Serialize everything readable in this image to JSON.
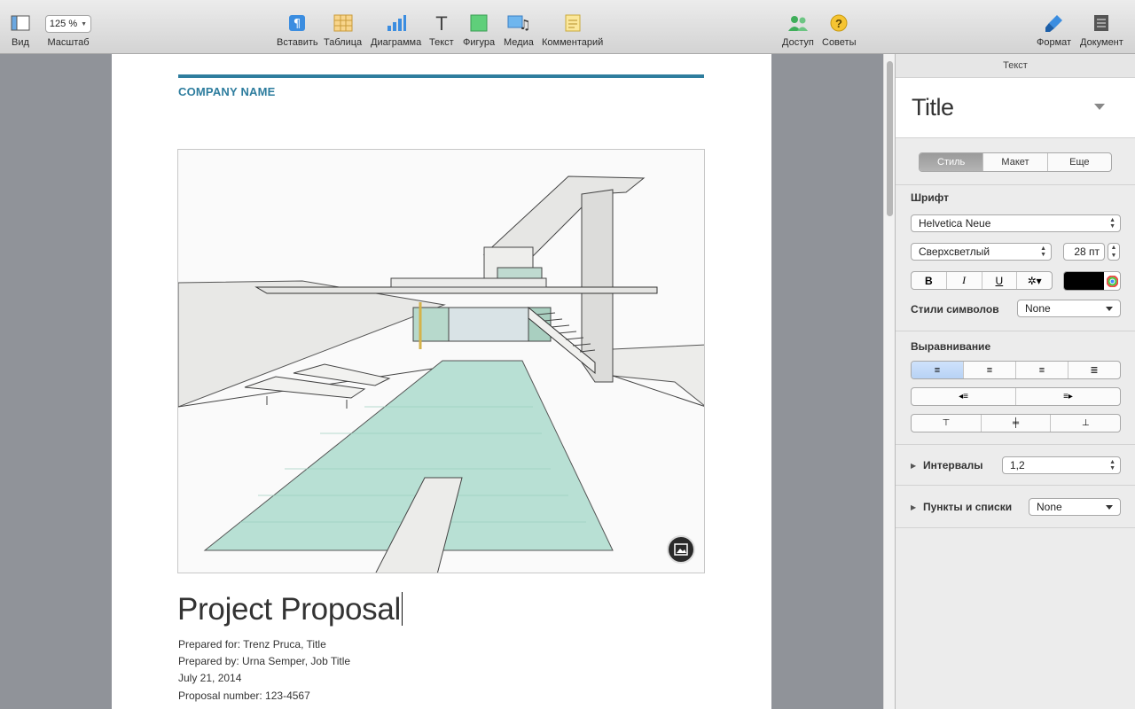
{
  "toolbar": {
    "left": [
      {
        "label": "Вид",
        "icon": "view-icon"
      },
      {
        "label": "Масштаб",
        "value": "125 %"
      }
    ],
    "center": [
      {
        "label": "Вставить",
        "icon": "insert-pilcrow-icon"
      },
      {
        "label": "Таблица",
        "icon": "table-icon"
      },
      {
        "label": "Диаграмма",
        "icon": "chart-icon"
      },
      {
        "label": "Текст",
        "icon": "text-icon"
      },
      {
        "label": "Фигура",
        "icon": "shape-icon"
      },
      {
        "label": "Медиа",
        "icon": "media-icon"
      },
      {
        "label": "Комментарий",
        "icon": "comment-icon"
      }
    ],
    "share": {
      "label": "Доступ",
      "icon": "share-people-icon"
    },
    "tips": {
      "label": "Советы",
      "icon": "question-icon"
    },
    "right": [
      {
        "label": "Формат",
        "icon": "format-brush-icon"
      },
      {
        "label": "Документ",
        "icon": "document-icon"
      }
    ],
    "accent": "#2e7d9e"
  },
  "document": {
    "company": "COMPANY NAME",
    "title": "Project Proposal",
    "prepared_for": "Prepared for: Trenz Pruca, Title",
    "prepared_by": "Prepared by: Urna Semper, Job Title",
    "date": "July 21, 2014",
    "proposal_number": "Proposal number: 123-4567"
  },
  "inspector": {
    "header": "Текст",
    "paragraph_style": "Title",
    "tabs": [
      "Стиль",
      "Макет",
      "Еще"
    ],
    "active_tab": "Стиль",
    "font_label": "Шрифт",
    "font_family": "Helvetica Neue",
    "font_weight": "Сверхсветлый",
    "font_size": "28 пт",
    "bold": "B",
    "italic": "I",
    "underline": "U",
    "text_color": "#000000",
    "char_styles_label": "Стили символов",
    "char_styles_value": "None",
    "alignment_label": "Выравнивание",
    "spacing_label": "Интервалы",
    "spacing_value": "1,2",
    "bullets_label": "Пункты и списки",
    "bullets_value": "None"
  }
}
